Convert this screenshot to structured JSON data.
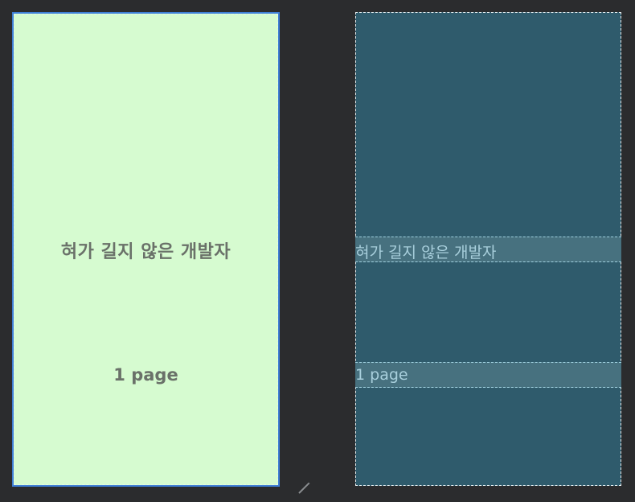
{
  "design_view": {
    "title_text": "혀가 길지 않은 개발자",
    "page_text": "1 page",
    "background": "#d6fbd0",
    "selection_border": "#3f7fd6"
  },
  "blueprint_view": {
    "title_text": "혀가 길지 않은 개발자",
    "page_text": "1 page",
    "background": "#2f5b6c"
  }
}
